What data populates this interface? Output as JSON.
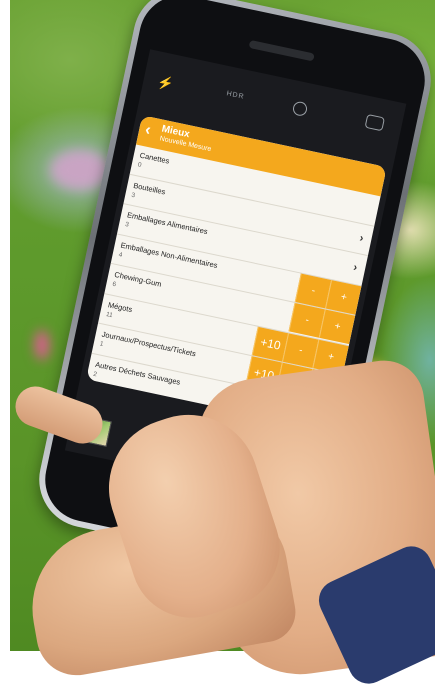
{
  "camera": {
    "hdr_label": "HDR"
  },
  "app": {
    "title": "Mieux",
    "subtitle": "Nouvelle Mesure",
    "items": [
      {
        "label": "Canettes",
        "count": "0"
      },
      {
        "label": "Bouteilles",
        "count": "3"
      },
      {
        "label": "Emballages Alimentaires",
        "count": "3"
      },
      {
        "label": "Emballages Non-Alimentaires",
        "count": "4"
      },
      {
        "label": "Chewing-Gum",
        "count": "6"
      },
      {
        "label": "Mégots",
        "count": "11"
      },
      {
        "label": "Journaux/Prospectus/Tickets",
        "count": "1"
      },
      {
        "label": "Autres Déchets Sauvages",
        "count": "2"
      }
    ],
    "plus10_label": "+10",
    "minus_label": "-",
    "plus_label": "+",
    "chevron": "›"
  },
  "colors": {
    "accent": "#f4a81d",
    "background_grass": "#5e9a2c"
  },
  "icons": [
    "back-arrow-icon",
    "flash-icon",
    "timer-icon",
    "flip-camera-icon",
    "chevron-right-icon",
    "shutter-button"
  ]
}
